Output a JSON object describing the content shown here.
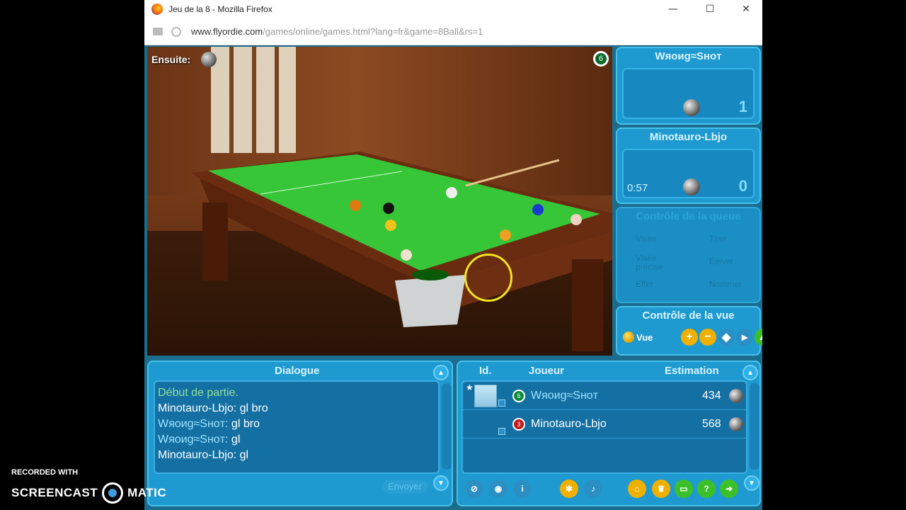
{
  "window": {
    "title": "Jeu de la 8 - Mozilla Firefox",
    "url_host": "www.flyordie.com",
    "url_path": "/games/online/games.html?lang=fr&game=8Ball&rs=1"
  },
  "window_controls": {
    "minimize": "—",
    "maximize": "☐",
    "close": "✕"
  },
  "scene": {
    "next_label": "Ensuite:",
    "corner_ball_number": "6"
  },
  "player1": {
    "name": "Wяoиg≈Sнoт",
    "score": "1"
  },
  "player2": {
    "name": "Minotauro-Lbjo",
    "timer": "0:57",
    "score": "0"
  },
  "shot_control": {
    "title": "Contrôle de la queue",
    "items": [
      "Visée",
      "Tirer",
      "Visée précise",
      "Élever",
      "Effet",
      "Nommer"
    ]
  },
  "view_control": {
    "title": "Contrôle de la vue",
    "vue_label": "Vue"
  },
  "chat": {
    "title": "Dialogue",
    "send_label": "Envoyer",
    "lines": [
      {
        "nick": "",
        "text": "Début de partie.",
        "sys": true
      },
      {
        "nick": "Minotauro-Lbjo:",
        "text": " gl bro",
        "me": false
      },
      {
        "nick": "Wяoиg≈Sнoт:",
        "text": " gl bro",
        "me": true
      },
      {
        "nick": "Wяoиg≈Sнoт:",
        "text": " gl",
        "me": true
      },
      {
        "nick": "Minotauro-Lbjo:",
        "text": " gl",
        "me": false
      }
    ]
  },
  "players": {
    "col_id": "Id.",
    "col_player": "Joueur",
    "col_rating": "Estimation",
    "rows": [
      {
        "name": "Wяoиg≈Sнoт",
        "ball": "6",
        "ball_color": "#0a8a3a",
        "rating": "434"
      },
      {
        "name": "Minotauro-Lbjo",
        "ball": "3",
        "ball_color": "#c01818",
        "rating": "568"
      }
    ]
  },
  "screencast": {
    "recorded": "RECORDED WITH",
    "brand_left": "SCREENCAST",
    "brand_right": "MATIC"
  },
  "colors": {
    "panel": "#1f9ad0",
    "felt": "#37c637",
    "accent": "#f2e31e"
  }
}
